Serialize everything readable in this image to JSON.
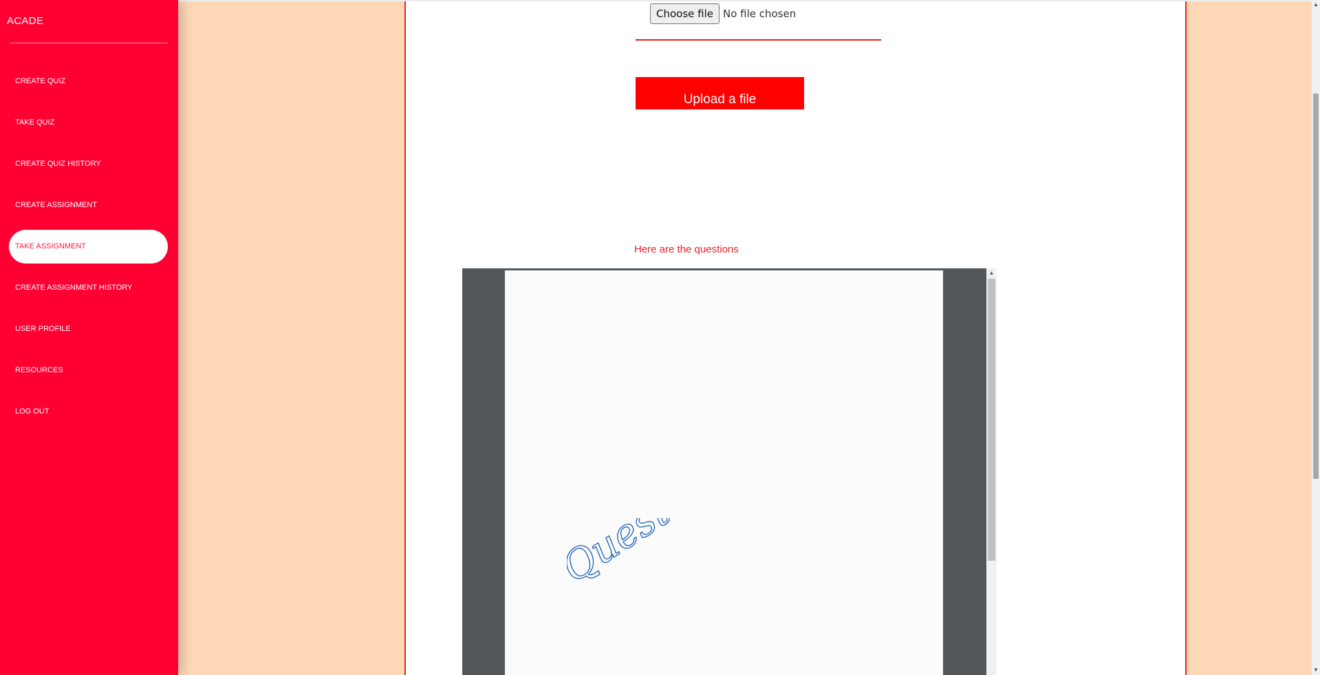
{
  "sidebar": {
    "brand": "ACADE",
    "items": [
      {
        "label": "CREATE QUIZ"
      },
      {
        "label": "TAKE QUIZ"
      },
      {
        "label": "CREATE QUIZ HISTORY"
      },
      {
        "label": "CREATE ASSIGNMENT"
      },
      {
        "label": "TAKE ASSIGNMENT",
        "active": true
      },
      {
        "label": "CREATE ASSIGNMENT HISTORY"
      },
      {
        "label": "USER PROFILE"
      },
      {
        "label": "RESOURCES"
      },
      {
        "label": "LOG OUT"
      }
    ]
  },
  "upload": {
    "choose_label": "Choose file",
    "file_status": "No file chosen",
    "upload_label": "Upload a file"
  },
  "questions": {
    "heading": "Here are the questions",
    "handwritten_text": "Question"
  },
  "colors": {
    "sidebar_bg": "#ff0033",
    "page_bg": "#fdd7b6",
    "accent_red": "#ff0000",
    "viewer_bg": "#525659",
    "ink_blue": "#1a5fb4"
  },
  "icons": {
    "scroll_up": "▲",
    "scroll_down": "▼"
  }
}
